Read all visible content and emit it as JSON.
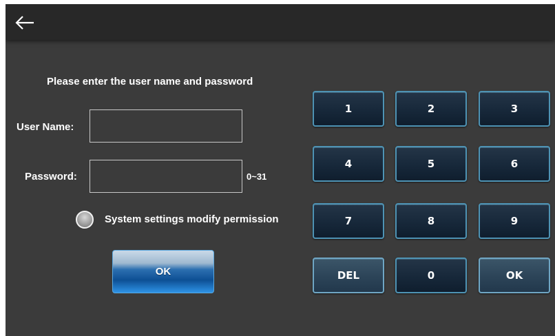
{
  "header": {
    "back_icon": "arrow-left-icon"
  },
  "form": {
    "prompt": "Please enter the user name and password",
    "username_label": "User Name:",
    "username_value": "",
    "password_label": "Password:",
    "password_value": "",
    "password_hint": "0~31",
    "permission_label": "System settings modify permission",
    "permission_checked": false,
    "ok_label": "OK"
  },
  "keypad": {
    "keys": [
      "1",
      "2",
      "3",
      "4",
      "5",
      "6",
      "7",
      "8",
      "9",
      "DEL",
      "0",
      "OK"
    ]
  },
  "colors": {
    "background": "#3b3b3b",
    "topbar": "#282828",
    "key_border": "#4e93b4",
    "key_fill": "#17283a",
    "ok_accent": "#0d4f94"
  }
}
